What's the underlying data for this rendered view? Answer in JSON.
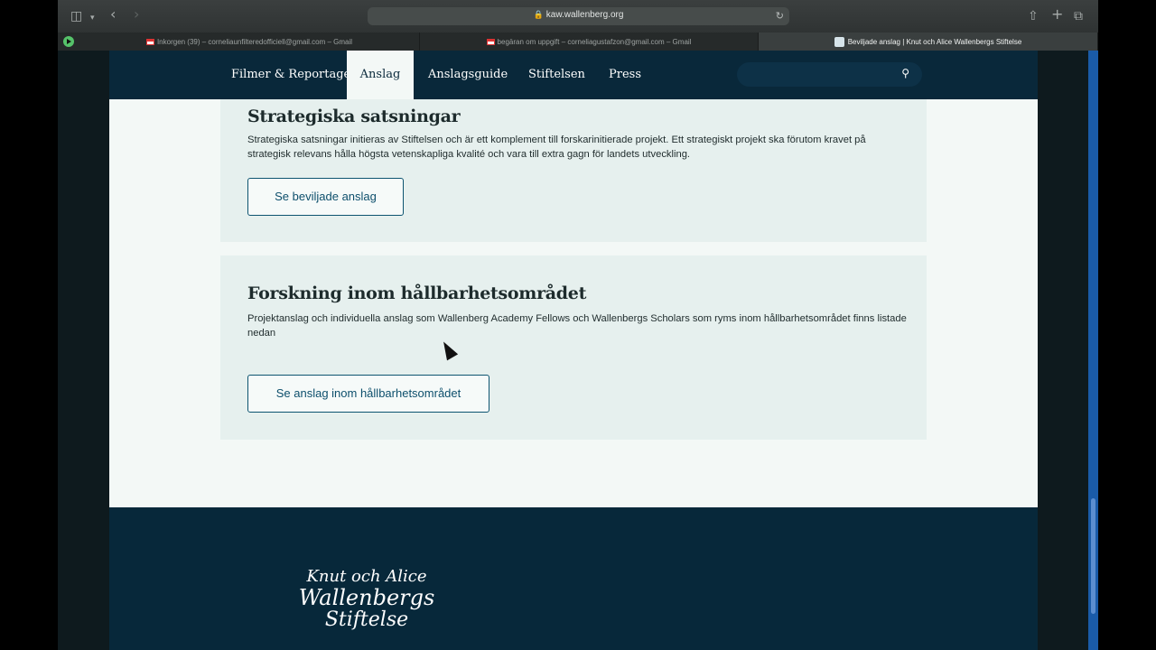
{
  "browser": {
    "url": "kaw.wallenberg.org",
    "tabs": [
      {
        "label": "Inkorgen (39) – cornelia​unfilteredofficiell@gmail.com – Gmail"
      },
      {
        "label": "begäran om uppgift – corneliagustafzon@gmail.com – Gmail"
      },
      {
        "label": "Beviljade anslag | Knut och Alice Wallenbergs Stiftelse"
      }
    ]
  },
  "nav": {
    "items": [
      {
        "label": "Filmer & Reportage"
      },
      {
        "label": "Anslag"
      },
      {
        "label": "Anslagsguide"
      },
      {
        "label": "Stiftelsen"
      },
      {
        "label": "Press"
      }
    ],
    "active": "Anslag",
    "search_placeholder": ""
  },
  "cards": [
    {
      "title": "Strategiska satsningar",
      "text": "Strategiska satsningar initieras av Stiftelsen och är ett komplement till forskarinitierade projekt. Ett strategiskt projekt ska förutom kravet på strategisk relevans hålla högsta vetenskapliga kvalité och vara till extra gagn för landets utveckling.",
      "button": "Se beviljade anslag"
    },
    {
      "title": "Forskning inom hållbarhetsområdet",
      "text": "Projektanslag och individuella anslag som Wallenberg Academy Fellows och Wallenbergs Scholars som ryms inom hållbarhetsområdet finns listade nedan",
      "button": "Se anslag inom hållbarhetsområdet"
    }
  ],
  "footer": {
    "logo_line1": "Knut och Alice",
    "logo_line2": "Wallenbergs",
    "logo_line3": "Stiftelse"
  },
  "colors": {
    "nav_bg": "#09283a",
    "page_bg": "#f3f8f6",
    "card_bg": "#e6f0ee",
    "button_border": "#0d5470"
  }
}
